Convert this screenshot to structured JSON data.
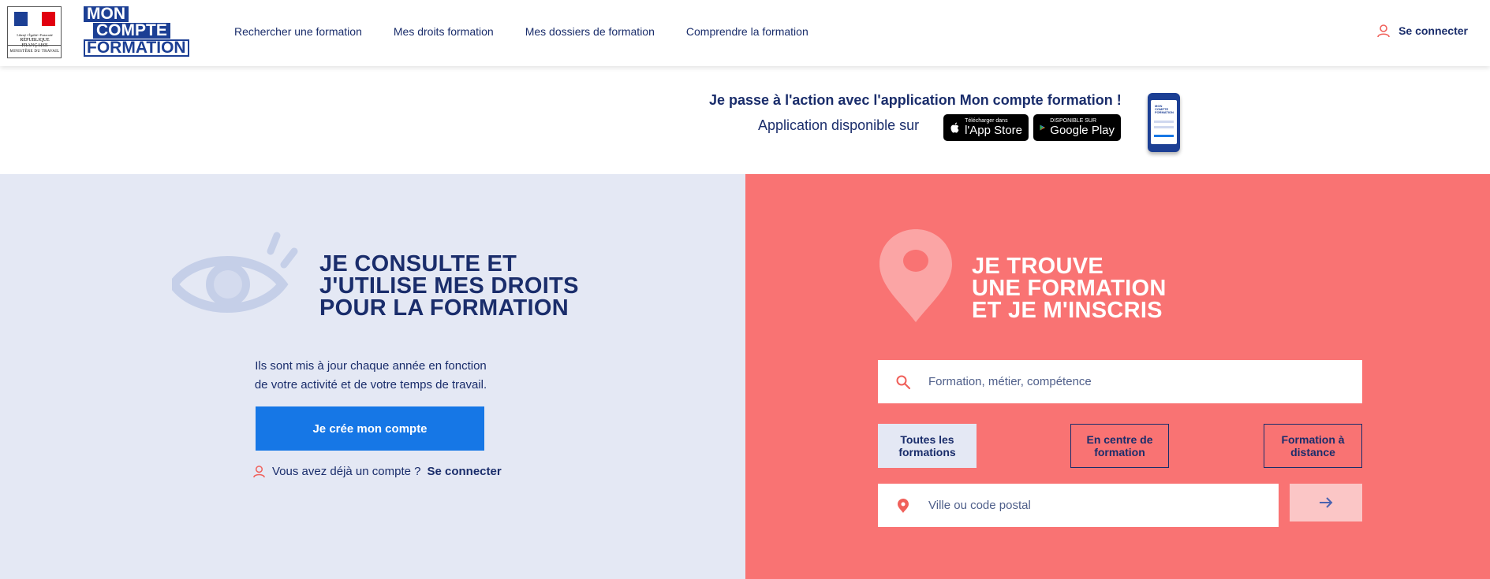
{
  "header": {
    "marianne": {
      "top_text": "Liberté • Égalité • Fraternité",
      "republic": "RÉPUBLIQUE FRANÇAISE",
      "ministry": "MINISTÈRE DU TRAVAIL"
    },
    "logo": {
      "line1": "MON",
      "line2": "COMPTE",
      "line3": "FORMATION"
    },
    "nav": [
      "Rechercher une formation",
      "Mes droits formation",
      "Mes dossiers de formation",
      "Comprendre la formation"
    ],
    "login_label": "Se connecter",
    "colors": {
      "brand_blue": "#1c3f94",
      "accent_red": "#f97373"
    }
  },
  "banner": {
    "title": "Je passe à l'action avec l'application Mon compte formation !",
    "subtitle": "Application disponible sur",
    "app_store": {
      "small": "Télécharger dans",
      "big": "l'App Store"
    },
    "google_play": {
      "small": "DISPONIBLE SUR",
      "big": "Google Play"
    },
    "phone_screen_logo": "MON COMPTE FORMATION"
  },
  "left": {
    "title_lines": [
      "JE CONSULTE ET",
      "J'UTILISE MES DROITS",
      "POUR LA FORMATION"
    ],
    "desc_lines": [
      "Ils sont mis à jour chaque année en fonction",
      "de votre activité et de votre temps de travail."
    ],
    "create_button": "Je crée mon compte",
    "have_account": "Vous avez déjà un compte ?",
    "login_link": "Se connecter"
  },
  "right": {
    "title_lines": [
      "JE TROUVE",
      "UNE FORMATION",
      "ET JE M'INSCRIS"
    ],
    "search_placeholder": "Formation, métier, compétence",
    "filters": [
      {
        "line1": "Toutes les",
        "line2": "formations"
      },
      {
        "line1": "En centre de",
        "line2": "formation"
      },
      {
        "line1": "Formation à",
        "line2": "distance"
      }
    ],
    "city_placeholder": "Ville ou code postal"
  }
}
